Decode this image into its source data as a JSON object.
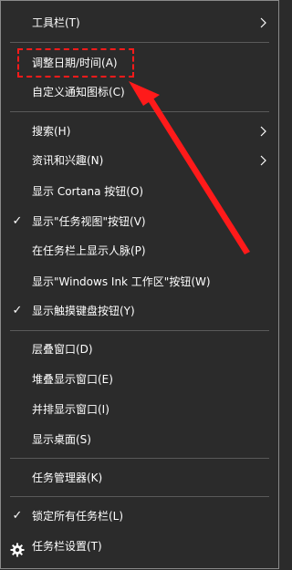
{
  "menu": {
    "items": [
      {
        "label": "工具栏(T)"
      },
      {
        "label": "调整日期/时间(A)"
      },
      {
        "label": "自定义通知图标(C)"
      },
      {
        "label": "搜索(H)"
      },
      {
        "label": "资讯和兴趣(N)"
      },
      {
        "label": "显示 Cortana 按钮(O)"
      },
      {
        "label": "显示\"任务视图\"按钮(V)"
      },
      {
        "label": "在任务栏上显示人脉(P)"
      },
      {
        "label": "显示\"Windows Ink 工作区\"按钮(W)"
      },
      {
        "label": "显示触摸键盘按钮(Y)"
      },
      {
        "label": "层叠窗口(D)"
      },
      {
        "label": "堆叠显示窗口(E)"
      },
      {
        "label": "并排显示窗口(I)"
      },
      {
        "label": "显示桌面(S)"
      },
      {
        "label": "任务管理器(K)"
      },
      {
        "label": "锁定所有任务栏(L)"
      },
      {
        "label": "任务栏设置(T)"
      }
    ],
    "check_glyph": "✓",
    "submenu_items": [
      "工具栏(T)",
      "搜索(H)",
      "资讯和兴趣(N)"
    ],
    "checked_items": [
      "显示\"任务视图\"按钮(V)",
      "显示触摸键盘按钮(Y)",
      "锁定所有任务栏(L)"
    ]
  },
  "colors": {
    "background": "#2b2b2b",
    "text": "#ffffff",
    "separator": "#5a5a5a",
    "annotation": "#ff1a1a"
  }
}
